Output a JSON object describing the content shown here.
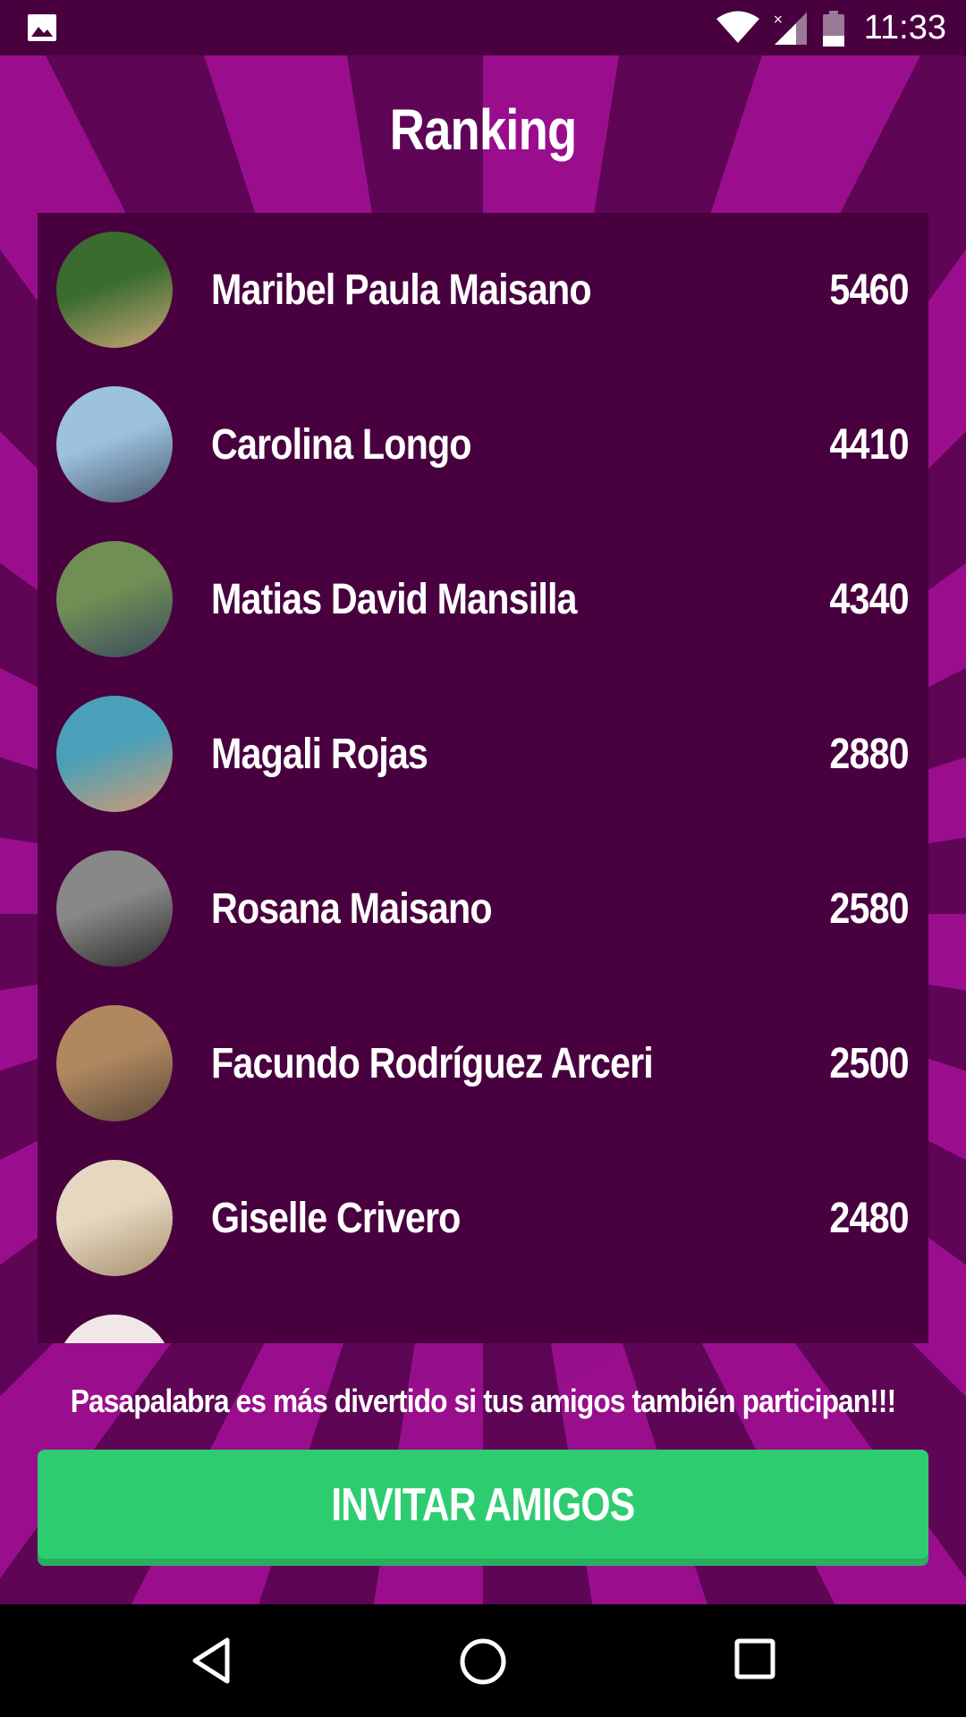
{
  "status_bar": {
    "time": "11:33",
    "icons": [
      "gallery-icon",
      "wifi-icon",
      "signal-icon",
      "battery-icon"
    ]
  },
  "title": "Ranking",
  "ranking": [
    {
      "name": "Maribel Paula Maisano",
      "score": "5460",
      "avatar_colors": [
        "#3a6b2f",
        "#c8a777"
      ]
    },
    {
      "name": "Carolina Longo",
      "score": "4410",
      "avatar_colors": [
        "#9cc2e0",
        "#4a5a6b"
      ]
    },
    {
      "name": "Matias David Mansilla",
      "score": "4340",
      "avatar_colors": [
        "#6f8f55",
        "#3b4a5e"
      ]
    },
    {
      "name": "Magali Rojas",
      "score": "2880",
      "avatar_colors": [
        "#4aa0b8",
        "#d49a72"
      ]
    },
    {
      "name": "Rosana Maisano",
      "score": "2580",
      "avatar_colors": [
        "#888888",
        "#2b2b2b"
      ]
    },
    {
      "name": "Facundo Rodríguez Arceri",
      "score": "2500",
      "avatar_colors": [
        "#b08860",
        "#5a4a3a"
      ]
    },
    {
      "name": "Giselle Crivero",
      "score": "2480",
      "avatar_colors": [
        "#e6d8c0",
        "#a89070"
      ]
    },
    {
      "name": "",
      "score": "",
      "avatar_colors": [
        "#f0e8e8",
        "#b04040"
      ]
    }
  ],
  "invite_message": "Pasapalabra es más divertido si tus amigos también participan!!!",
  "invite_button_label": "INVITAR AMIGOS",
  "colors": {
    "background": "#48003f",
    "ray_light": "#9a0e8e",
    "ray_dark": "#5e0556",
    "button": "#2ecc71"
  },
  "nav_bar": {
    "icons": [
      "back-icon",
      "home-icon",
      "recents-icon"
    ]
  }
}
